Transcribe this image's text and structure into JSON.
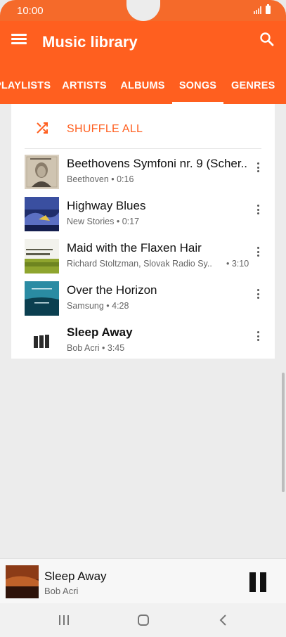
{
  "status": {
    "time": "10:00"
  },
  "app_bar": {
    "title": "Music library",
    "accent": "#ff5f1f",
    "tabs": [
      {
        "label": "PLAYLISTS",
        "active": false
      },
      {
        "label": "ARTISTS",
        "active": false
      },
      {
        "label": "ALBUMS",
        "active": false
      },
      {
        "label": "SONGS",
        "active": true
      },
      {
        "label": "GENRES",
        "active": false
      }
    ]
  },
  "list": {
    "shuffle_label": "SHUFFLE ALL",
    "songs": [
      {
        "title": "Beethovens Symfoni nr. 9 (Scher..",
        "subtitle": "Beethoven • 0:16",
        "art": "beethoven-album-art",
        "playing": false
      },
      {
        "title": "Highway Blues",
        "subtitle": "New Stories • 0:17",
        "art": "highway-blues-album-art",
        "playing": false
      },
      {
        "title": "Maid with the Flaxen Hair",
        "subtitle": "Richard Stoltzman, Slovak Radio Sy..",
        "duration": "• 3:10",
        "art": "richard-stoltzman-album-art",
        "playing": false
      },
      {
        "title": "Over the Horizon",
        "subtitle": "Samsung • 4:28",
        "art": "over-the-horizon-album-art",
        "playing": false
      },
      {
        "title": "Sleep Away",
        "subtitle": "Bob Acri • 3:45",
        "art": "now-playing-bars-icon",
        "playing": true
      }
    ]
  },
  "player": {
    "title": "Sleep Away",
    "artist": "Bob Acri",
    "control": "pause-icon"
  },
  "navbar": {
    "buttons": [
      "recent-apps-icon",
      "home-icon",
      "back-icon"
    ]
  }
}
